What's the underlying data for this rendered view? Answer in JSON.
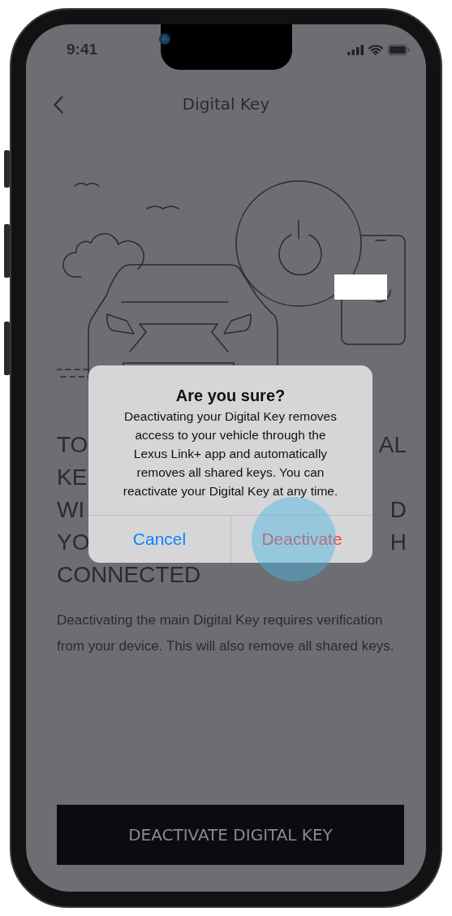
{
  "status_bar": {
    "time": "9:41"
  },
  "nav": {
    "title": "Digital Key"
  },
  "heading": {
    "lines": [
      {
        "left": "TO",
        "right": "AL"
      },
      {
        "left": "KE"
      },
      {
        "left": "WI",
        "right": "D"
      },
      {
        "left": "YO",
        "right": "H"
      },
      {
        "left": "CONNECTED"
      }
    ]
  },
  "description": "Deactivating the main Digital Key requires verification from your device. This will also remove all shared keys.",
  "primary_button": {
    "label": "DEACTIVATE DIGITAL KEY"
  },
  "alert": {
    "title": "Are you sure?",
    "message": "Deactivating your Digital Key removes access to your vehicle through the Lexus Link+ app and automatically removes all shared keys. You can reactivate your Digital Key at any time.",
    "actions": [
      {
        "label": "Cancel",
        "kind": "cancel",
        "touched": false
      },
      {
        "label": "Deactivate",
        "kind": "destructive",
        "touched": true
      }
    ]
  }
}
